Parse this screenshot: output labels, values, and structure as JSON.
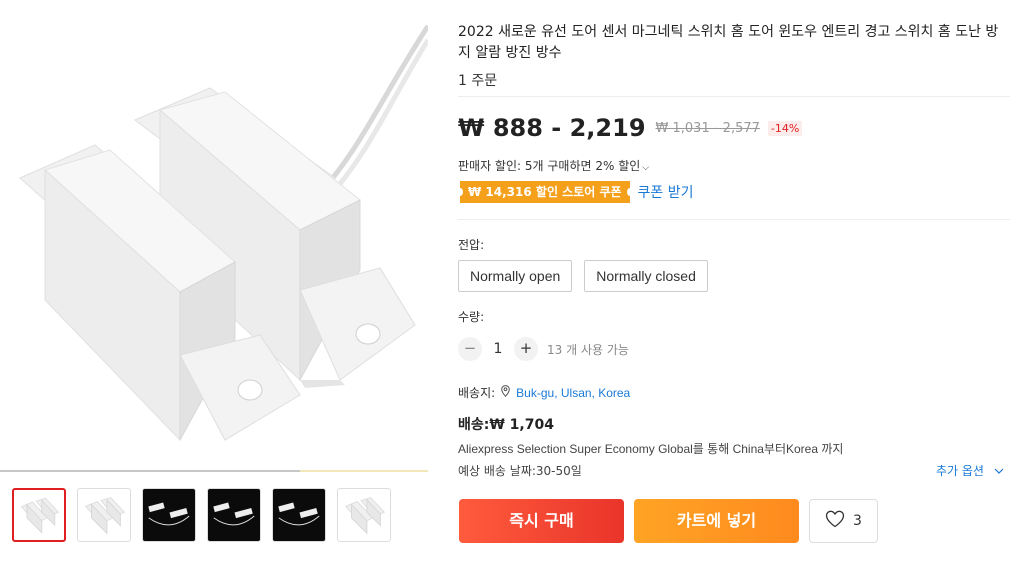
{
  "gallery": {
    "thumbnails": [
      {
        "name": "thumb-1",
        "dark": false,
        "active": true
      },
      {
        "name": "thumb-2",
        "dark": false,
        "active": false
      },
      {
        "name": "thumb-3",
        "dark": true,
        "active": false
      },
      {
        "name": "thumb-4",
        "dark": true,
        "active": false
      },
      {
        "name": "thumb-5",
        "dark": true,
        "active": false
      },
      {
        "name": "thumb-6",
        "dark": false,
        "active": false
      }
    ],
    "scroll_progress": 0.7
  },
  "product": {
    "title": "2022 새로운 유선 도어 센서 마그네틱 스위치 홈 도어 윈도우 엔트리 경고 스위치 홈 도난 방지 알람 방진 방수",
    "orders": "1 주문",
    "price": "₩ 888 - 2,219",
    "original_price": "₩ 1,031 - 2,577",
    "discount": "-14%",
    "seller_discount": "판매자 할인: 5개 구매하면 2% 할인",
    "coupon": "₩ 14,316 할인 스토어 쿠폰",
    "coupon_link": "쿠폰 받기"
  },
  "options": {
    "label": "전압:",
    "values": [
      "Normally open",
      "Normally closed"
    ]
  },
  "quantity": {
    "label": "수량:",
    "minus": "−",
    "value": "1",
    "plus": "+",
    "available": "13 개 사용 가능"
  },
  "shipping": {
    "to_label": "배송지:",
    "location": "Buk-gu, Ulsan, Korea",
    "cost": "배송:₩ 1,704",
    "via": "Aliexpress Selection Super Economy Global를 통해 China부터Korea 까지",
    "delivery": "예상 배송 날짜:30-50일",
    "more_options": "추가 옵션"
  },
  "actions": {
    "buy_now": "즉시 구매",
    "add_to_cart": "카트에 넣기",
    "wishlist_count": "3"
  },
  "colors": {
    "accent_red": "#e9342a",
    "accent_orange": "#ff8a1e",
    "coupon": "#f4a01b",
    "link": "#1a79d6"
  }
}
